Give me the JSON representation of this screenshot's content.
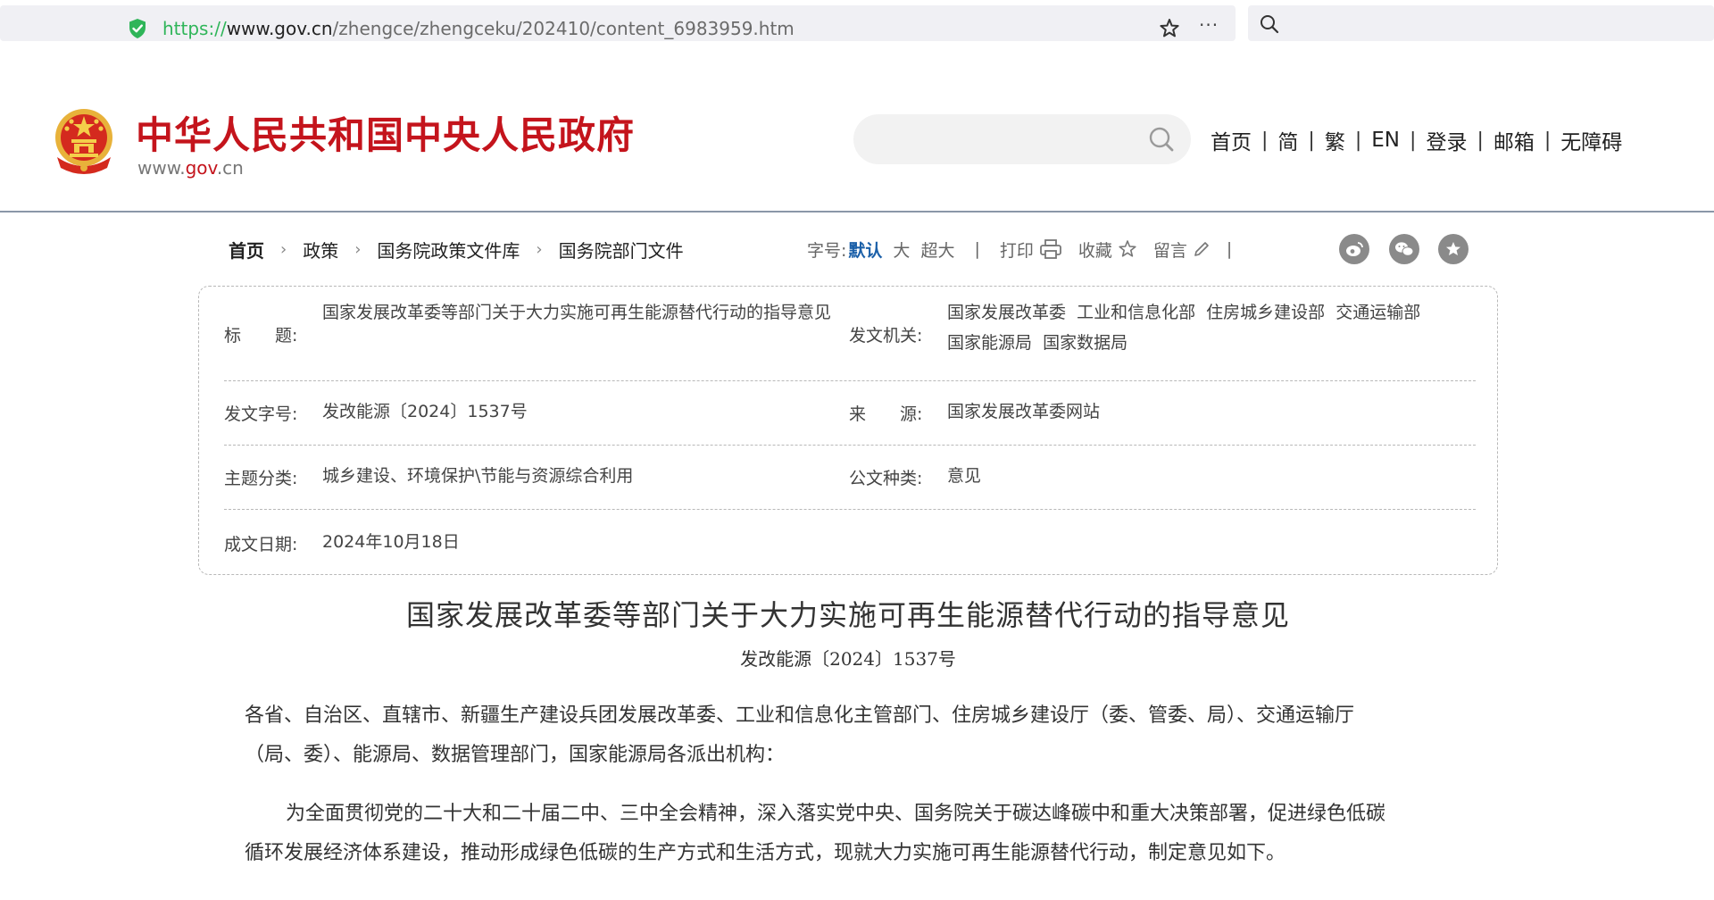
{
  "browser": {
    "url_proto": "https://",
    "url_host": "www.gov.cn",
    "url_path": "/zhengce/zhengceku/202410/content_6983959.htm",
    "secure_color": "#2fb559",
    "star_icon": "star-icon",
    "more_label": "···",
    "search_icon": "search-icon"
  },
  "header": {
    "site_name": "中华人民共和国中央人民政府",
    "domain_prefix": "www.",
    "domain_gov": "gov",
    "domain_suffix": ".cn",
    "brand_color": "#c4141c",
    "search_placeholder": "",
    "nav": [
      "首页",
      "简",
      "繁",
      "EN",
      "登录",
      "邮箱",
      "无障碍"
    ],
    "nav_separator": "|"
  },
  "breadcrumb": {
    "items": [
      "首页",
      "政策",
      "国务院政策文件库",
      "国务院部门文件"
    ],
    "separator": "›"
  },
  "toolbar": {
    "font_size_label": "字号:",
    "font_sizes": [
      "默认",
      "大",
      "超大"
    ],
    "active_font_color": "#1a5fa8",
    "separator": "|",
    "print_label": "打印",
    "favorite_label": "收藏",
    "comment_label": "留言",
    "share_icons": [
      "weibo-icon",
      "wechat-icon",
      "star-share-icon"
    ]
  },
  "meta": {
    "title_label": "标　　题:",
    "title_value": "国家发展改革委等部门关于大力实施可再生能源替代行动的指导意见",
    "issuer_label": "发文机关:",
    "issuer_value_line1": "国家发展改革委  工业和信息化部  住房城乡建设部  交通运输部",
    "issuer_value_line2": "国家能源局  国家数据局",
    "doc_no_label": "发文字号:",
    "doc_no_value": "发改能源〔2024〕1537号",
    "source_label": "来　　源:",
    "source_value": "国家发展改革委网站",
    "subject_label": "主题分类:",
    "subject_value": "城乡建设、环境保护\\节能与资源综合利用",
    "type_label": "公文种类:",
    "type_value": "意见",
    "date_label": "成文日期:",
    "date_value": "2024年10月18日"
  },
  "article": {
    "title": "国家发展改革委等部门关于大力实施可再生能源替代行动的指导意见",
    "doc_number": "发改能源〔2024〕1537号",
    "p1_line1": "各省、自治区、直辖市、新疆生产建设兵团发展改革委、工业和信息化主管部门、住房城乡建设厅（委、管委、局）、交通运输厅",
    "p1_line2": "（局、委）、能源局、数据管理部门，国家能源局各派出机构：",
    "p2_line1": "为全面贯彻党的二十大和二十届二中、三中全会精神，深入落实党中央、国务院关于碳达峰碳中和重大决策部署，促进绿色低碳",
    "p2_line2": "循环发展经济体系建设，推动形成绿色低碳的生产方式和生活方式，现就大力实施可再生能源替代行动，制定意见如下。"
  }
}
